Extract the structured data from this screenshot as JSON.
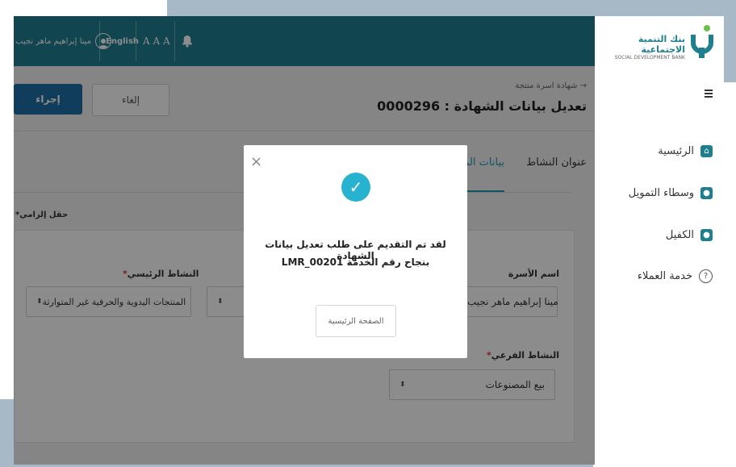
{
  "topbar": {
    "user_name": "مينا إبراهيم ماهر نجيب",
    "language_label": "English",
    "font_size_label": "A A A"
  },
  "logo": {
    "arabic_name": "بنك التنمية الاجتماعية",
    "english_name": "SOCIAL DEVELOPMENT BANK"
  },
  "sidebar": {
    "items": [
      {
        "label": "الرئيسية"
      },
      {
        "label": "وسطاء التمويل"
      },
      {
        "label": "الكفيل"
      },
      {
        "label": "خدمة العملاء"
      }
    ]
  },
  "header": {
    "breadcrumb": "شهادة اسرة منتجة",
    "title": "تعديل بيانات الشهادة : 0000296",
    "cancel_label": "إلغاء",
    "action_label": "إجراء"
  },
  "tabs": [
    {
      "label": "عنوان النشاط"
    },
    {
      "label": "بيانات الم"
    }
  ],
  "form": {
    "required_note": "حقل إلزامي*",
    "family_name_label": "اسم الأسرة",
    "family_name_value": "مينا إبراهيم ماهر نجيب",
    "main_activity_label": "النشاط الرئيسي",
    "main_activity_value": "المنتجات اليدوية والحرفية غير المتوارثة",
    "sub_activity_label": "النشاط الفرعي",
    "sub_activity_value": "بيع المصنوعات",
    "required_mark": "*"
  },
  "modal": {
    "close_symbol": "×",
    "message_line1": "لقد تم التقديم على طلب تعديل بيانات الشهادة",
    "message_line2": "بنجاح رقم الخدمة LMR_00201",
    "home_button": "الصفحة الرئيسية"
  },
  "colors": {
    "topbar": "#1f7f90",
    "primary_button": "#1f6fa8",
    "success": "#27b2cf",
    "tab_underline": "#1f9bb8"
  }
}
